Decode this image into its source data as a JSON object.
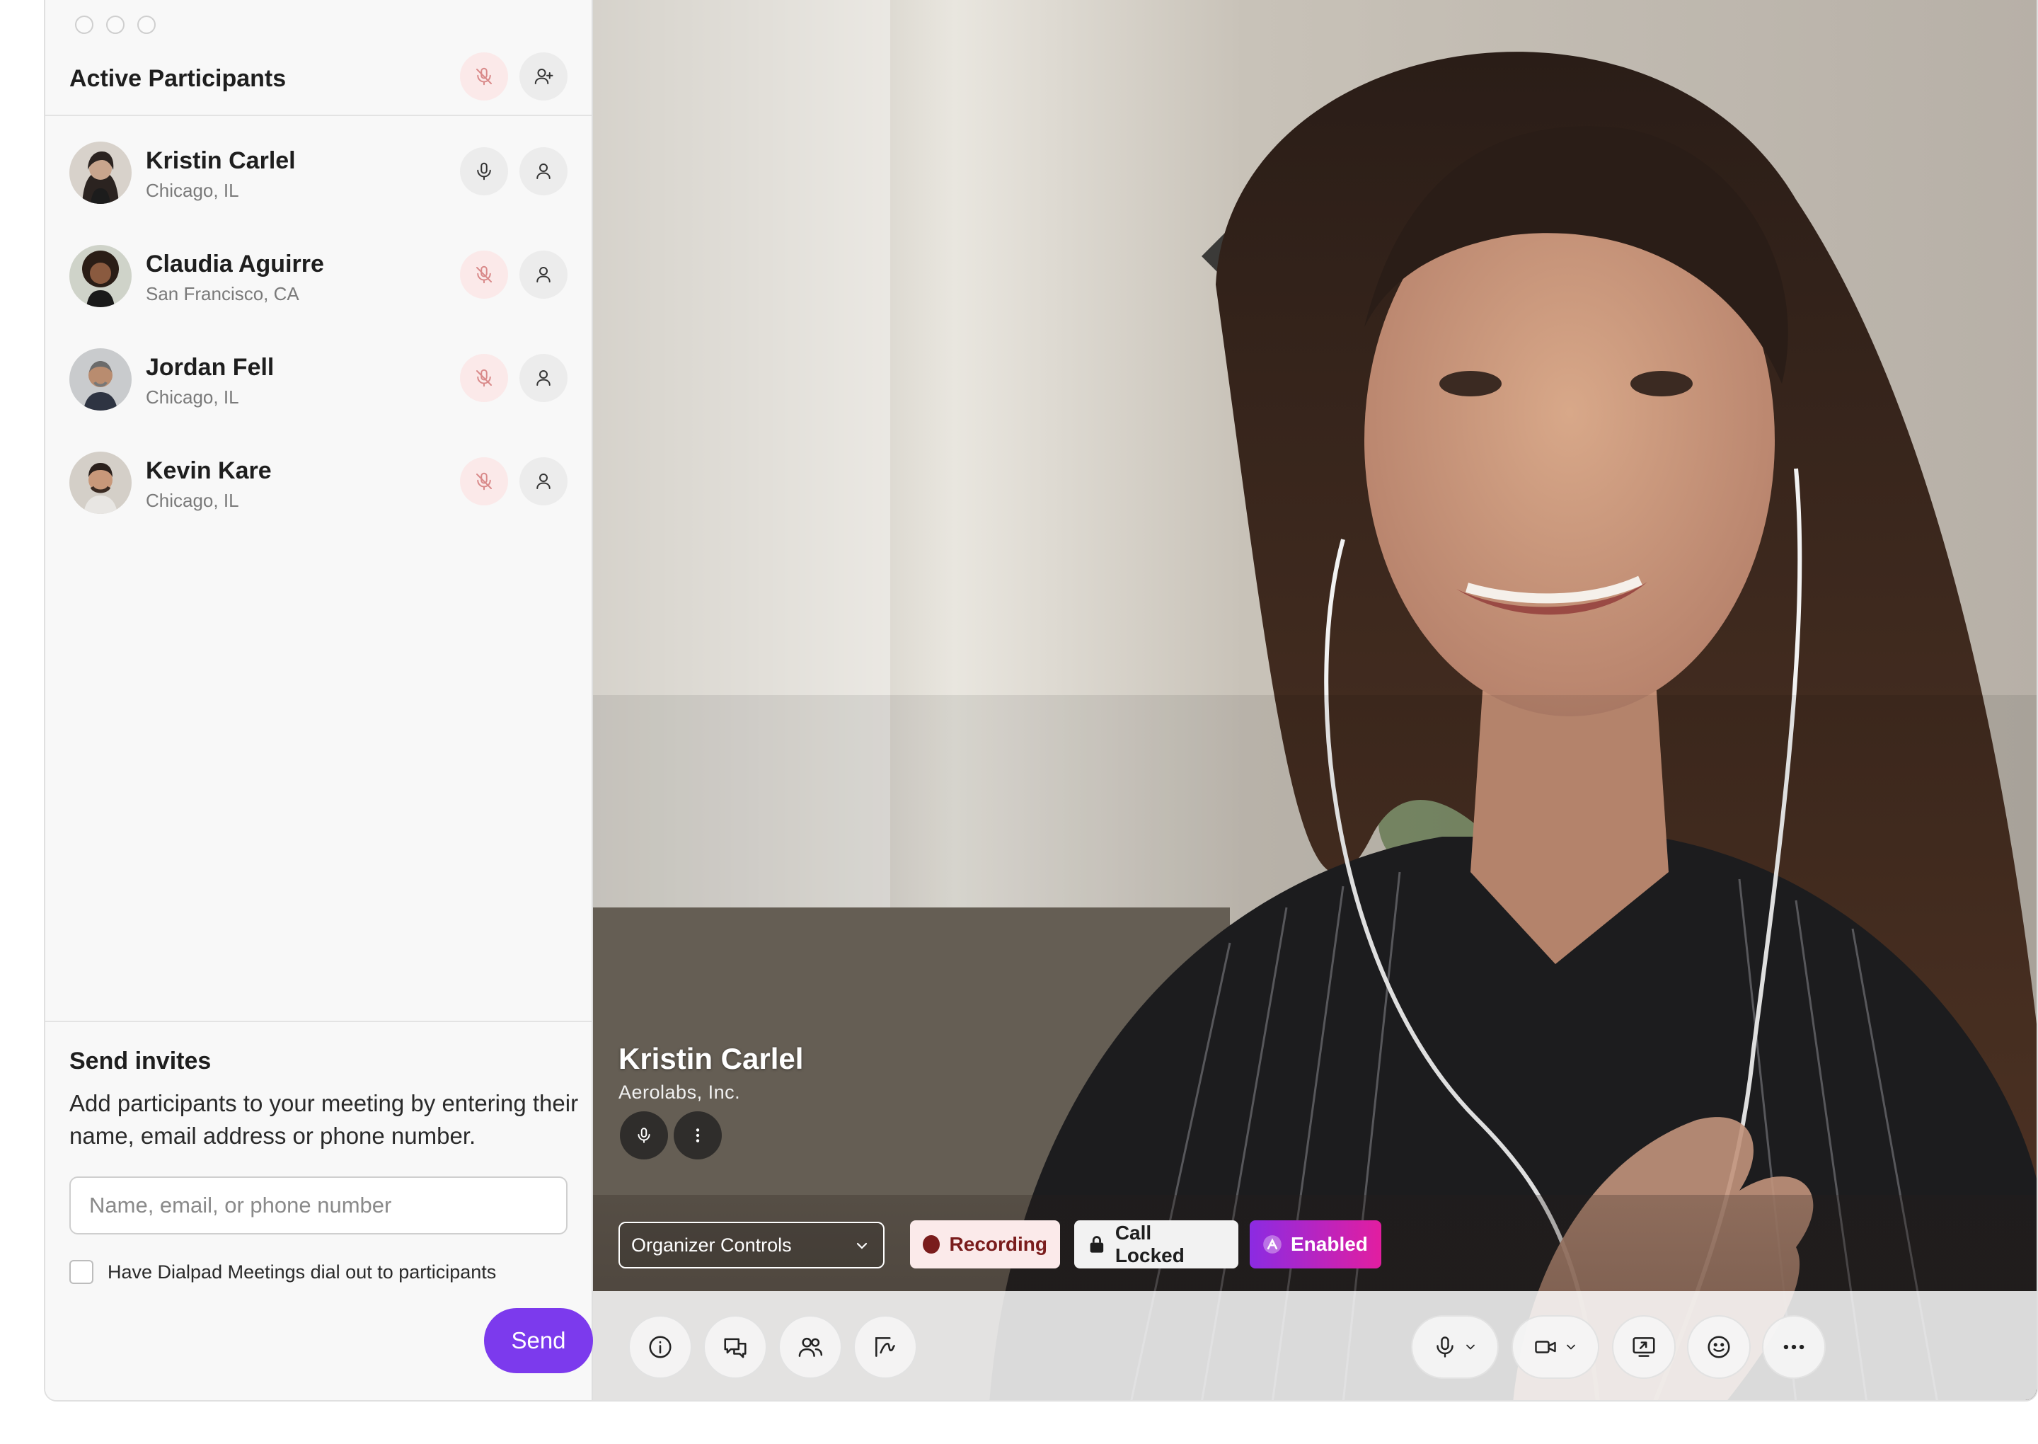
{
  "sidebar": {
    "title": "Active Participants",
    "participants": [
      {
        "name": "Kristin Carlel",
        "location": "Chicago, IL",
        "muted": false
      },
      {
        "name": "Claudia Aguirre",
        "location": "San Francisco, CA",
        "muted": true
      },
      {
        "name": "Jordan Fell",
        "location": "Chicago, IL",
        "muted": true
      },
      {
        "name": "Kevin Kare",
        "location": "Chicago, IL",
        "muted": true
      }
    ]
  },
  "invites": {
    "title": "Send invites",
    "description": "Add participants to your meeting by entering their name, email address or phone number.",
    "input_placeholder": "Name, email, or phone number",
    "input_value": "",
    "checkbox_label": "Have Dialpad Meetings dial out to participants",
    "checkbox_checked": false,
    "send_label": "Send"
  },
  "video": {
    "speaker_name": "Kristin Carlel",
    "speaker_org": "Aerolabs, Inc.",
    "organizer_controls": "Organizer Controls",
    "recording_label": "Recording",
    "call_locked_label": "Call Locked",
    "enabled_label": "Enabled"
  },
  "toolbar": {
    "left": [
      "info-icon",
      "chat-icon",
      "participants-icon",
      "whiteboard-icon"
    ],
    "right": [
      "microphone-icon",
      "camera-icon",
      "screen-share-icon",
      "emoji-icon",
      "more-icon"
    ]
  },
  "colors": {
    "accent": "#7c3aed",
    "recording": "#7a1c1c",
    "muted_bg": "#fbe9e9"
  }
}
